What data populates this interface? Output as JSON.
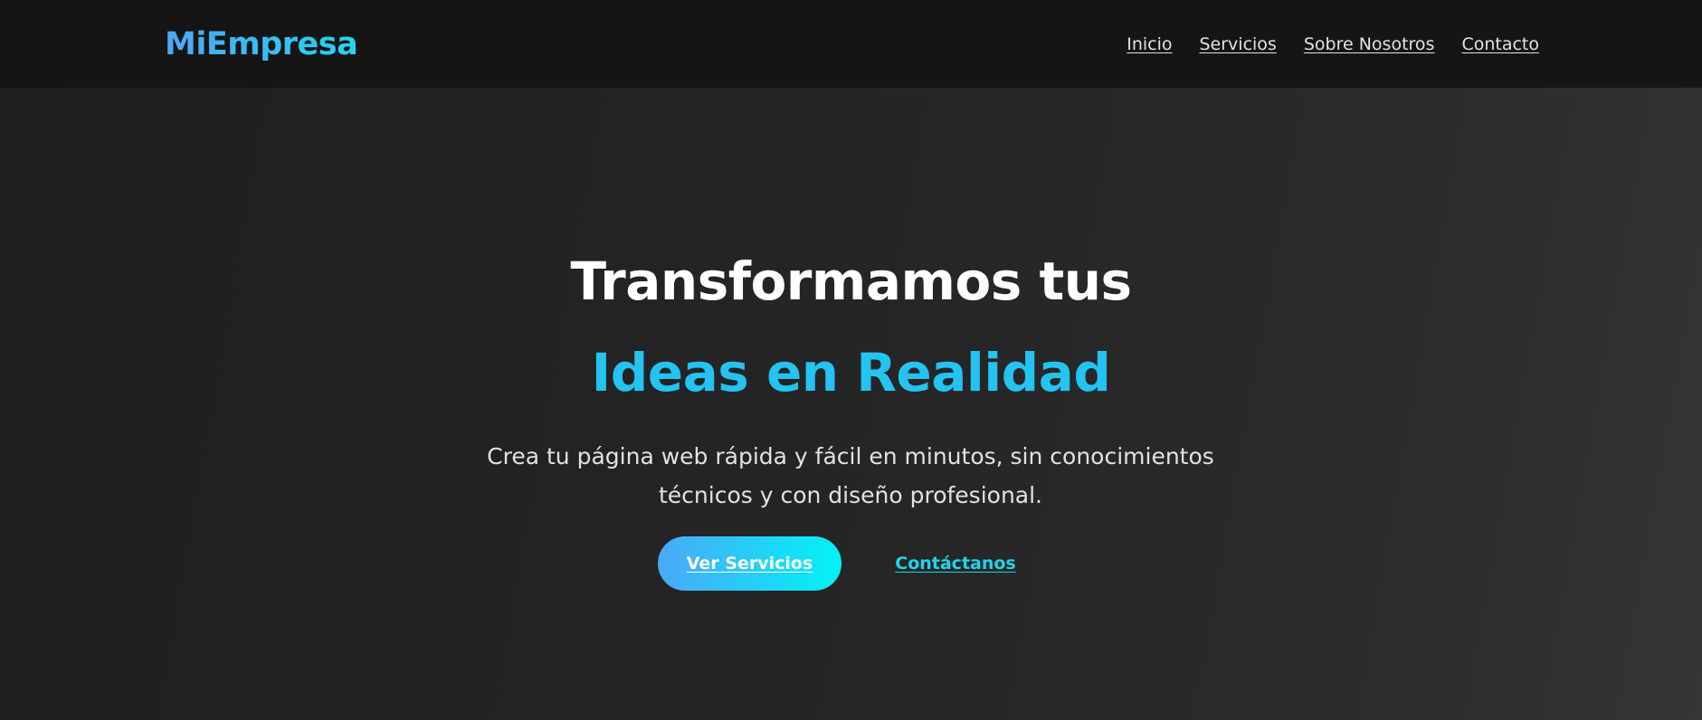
{
  "navbar": {
    "logo": "MiEmpresa",
    "links": [
      {
        "label": "Inicio"
      },
      {
        "label": "Servicios"
      },
      {
        "label": "Sobre Nosotros"
      },
      {
        "label": "Contacto"
      }
    ]
  },
  "hero": {
    "title_line1": "Transformamos tus",
    "title_line2": "Ideas en Realidad",
    "subtitle": "Crea tu página web rápida y fácil en minutos, sin conocimientos técnicos y con diseño profesional.",
    "primary_button": "Ver Servicios",
    "secondary_button": "Contáctanos"
  },
  "colors": {
    "accent_blue": "#4ea6f7",
    "accent_cyan": "#22d6ef",
    "headline_accent": "#23c3f2",
    "navbar_bg": "#151515",
    "hero_bg": "#242424"
  }
}
